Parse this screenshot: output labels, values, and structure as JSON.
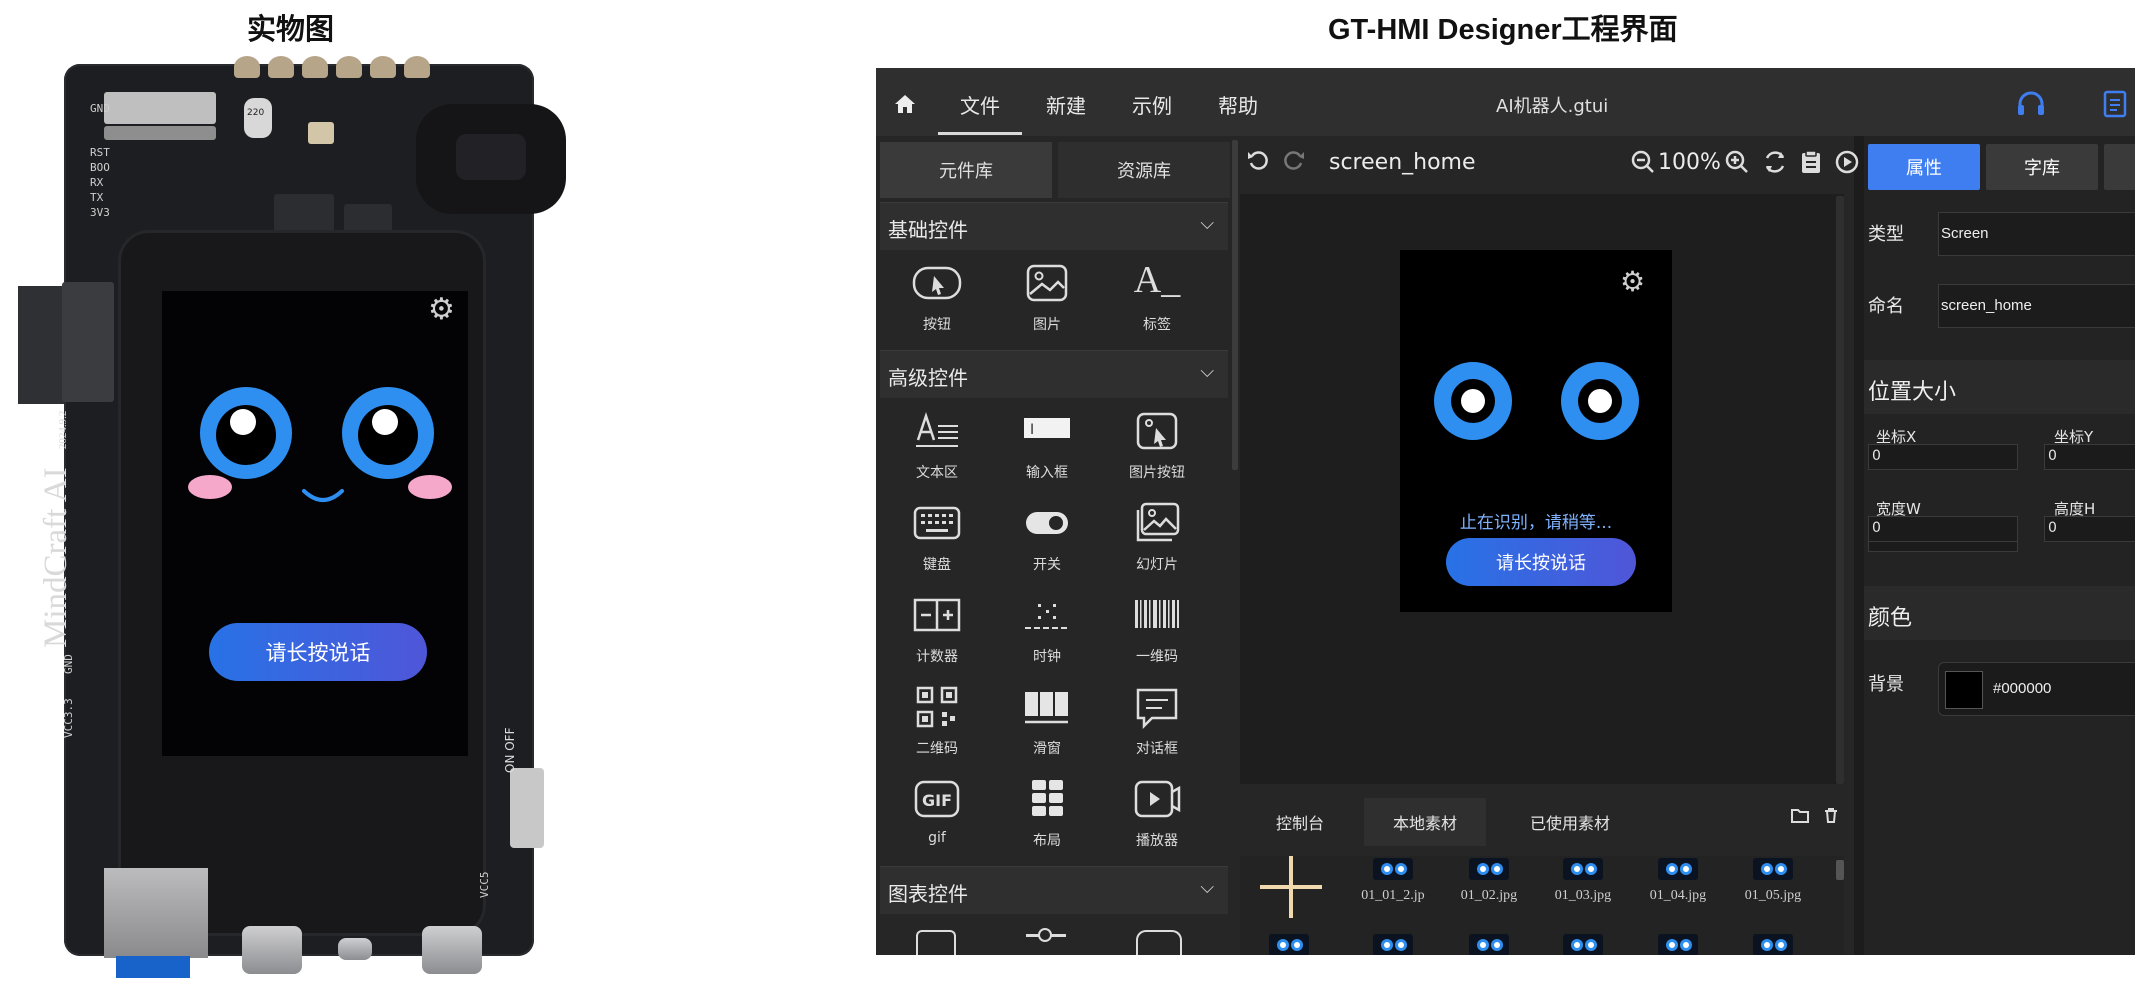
{
  "captions": {
    "left": "实物图",
    "right": "GT-HMI Designer工程界面"
  },
  "board": {
    "pins": [
      "GND",
      "RST",
      "BOO",
      "RX",
      "TX",
      "3V3"
    ],
    "brand": "MindCraft AI",
    "date": "2024.9.2",
    "vcc33": "VCC3.3",
    "gnd": "GND",
    "vcc5": "VCC5",
    "onoff": "ON OFF",
    "capacitor": "220"
  },
  "device_screen": {
    "button_label": "请长按说话"
  },
  "app": {
    "menu": [
      "文件",
      "新建",
      "示例",
      "帮助"
    ],
    "file_title": "AI机器人.gtui",
    "left_tabs": [
      "元件库",
      "资源库"
    ],
    "sections": {
      "basic": "基础控件",
      "advanced": "高级控件",
      "chart": "图表控件"
    },
    "basic_widgets": [
      "按钮",
      "图片",
      "标签"
    ],
    "advanced_widgets": [
      "文本区",
      "输入框",
      "图片按钮",
      "键盘",
      "开关",
      "幻灯片",
      "计数器",
      "时钟",
      "一维码",
      "二维码",
      "滑窗",
      "对话框",
      "gif",
      "布局",
      "播放器"
    ],
    "icon_text": {
      "label": "A_",
      "gif": "GIF",
      "input_cursor": "I"
    },
    "chevron": "⌵",
    "screen_name": "screen_home",
    "zoom": "100%",
    "canvas": {
      "status_text": "止在识别，请稍等...",
      "button_label": "请长按说话"
    },
    "bottom_tabs": [
      "控制台",
      "本地素材",
      "已使用素材"
    ],
    "assets": [
      "01_01_2.jp",
      "01_02.jpg",
      "01_03.jpg",
      "01_04.jpg",
      "01_05.jpg"
    ],
    "right_tabs": [
      "属性",
      "字库"
    ],
    "props": {
      "type_label": "类型",
      "type_value": "Screen",
      "name_label": "命名",
      "name_value": "screen_home",
      "pos_section": "位置大小",
      "x_label": "坐标X",
      "x_value": "0",
      "y_label": "坐标Y",
      "y_value": "0",
      "w_label": "宽度W",
      "w_value": "0",
      "h_label": "高度H",
      "h_value": "0",
      "color_section": "颜色",
      "bg_label": "背景",
      "bg_value": "#000000"
    },
    "colors": {
      "accent": "#3f7ef0",
      "eye": "#2e8ff0",
      "cheek": "#f6a8cb"
    }
  }
}
